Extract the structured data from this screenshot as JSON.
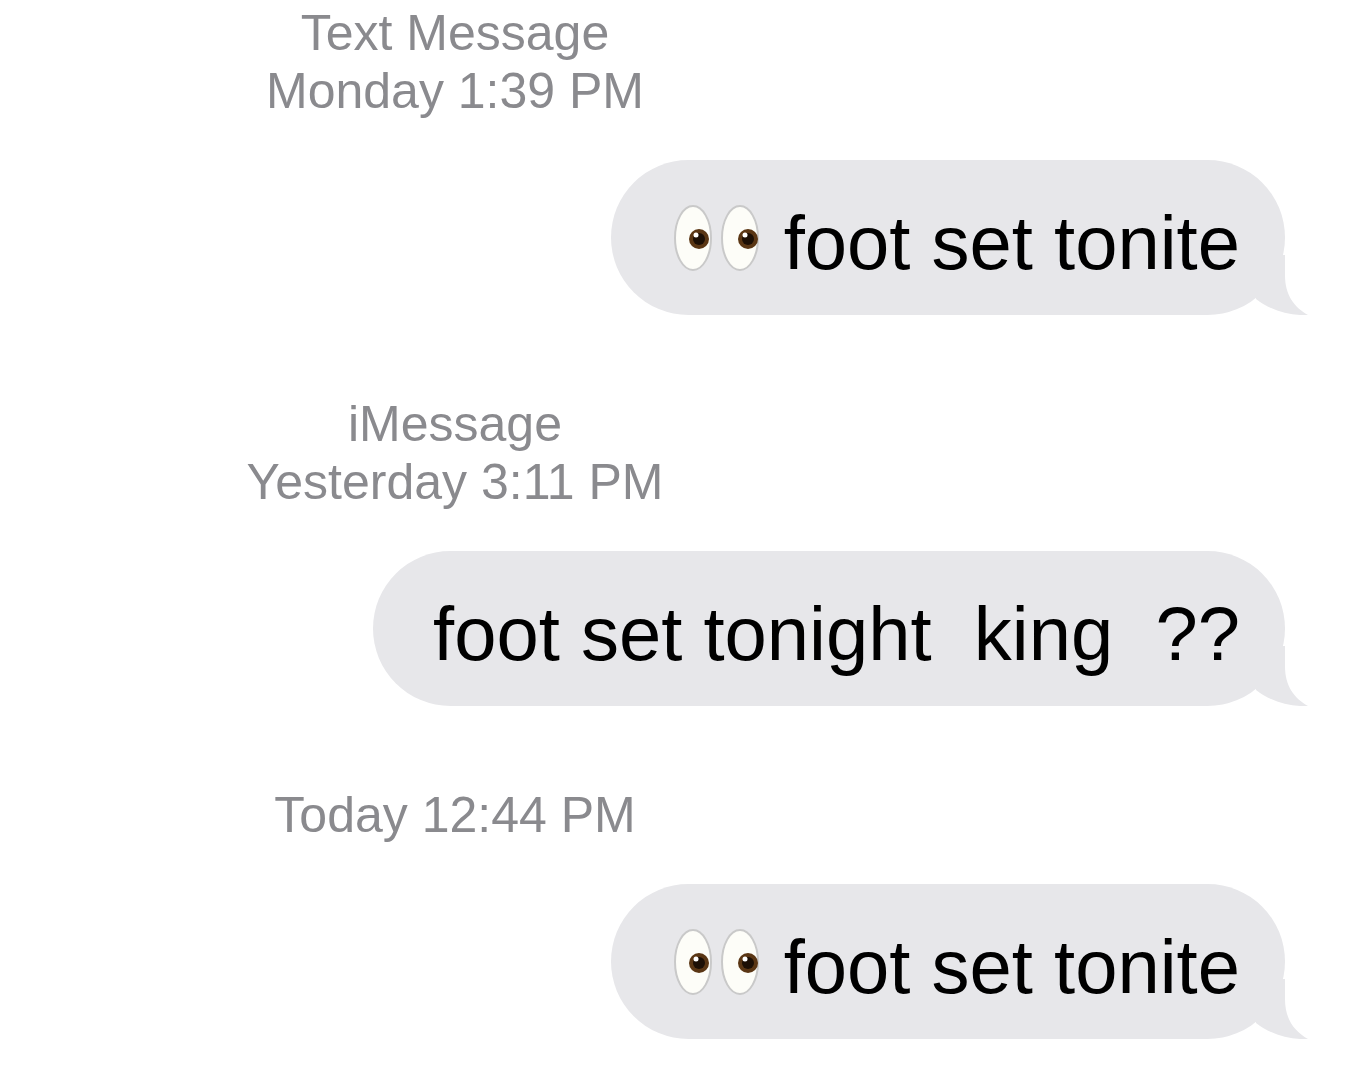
{
  "messages": [
    {
      "service": "Text Message",
      "time": "Monday 1:39 PM",
      "text": "foot set tonite",
      "kind": "eyes"
    },
    {
      "service": "iMessage",
      "time": "Yesterday 3:11 PM",
      "text": "foot set tonight  king  ??",
      "kind": "plain"
    },
    {
      "time": "Today 12:44 PM",
      "text": "foot set tonite",
      "kind": "eyes"
    }
  ]
}
